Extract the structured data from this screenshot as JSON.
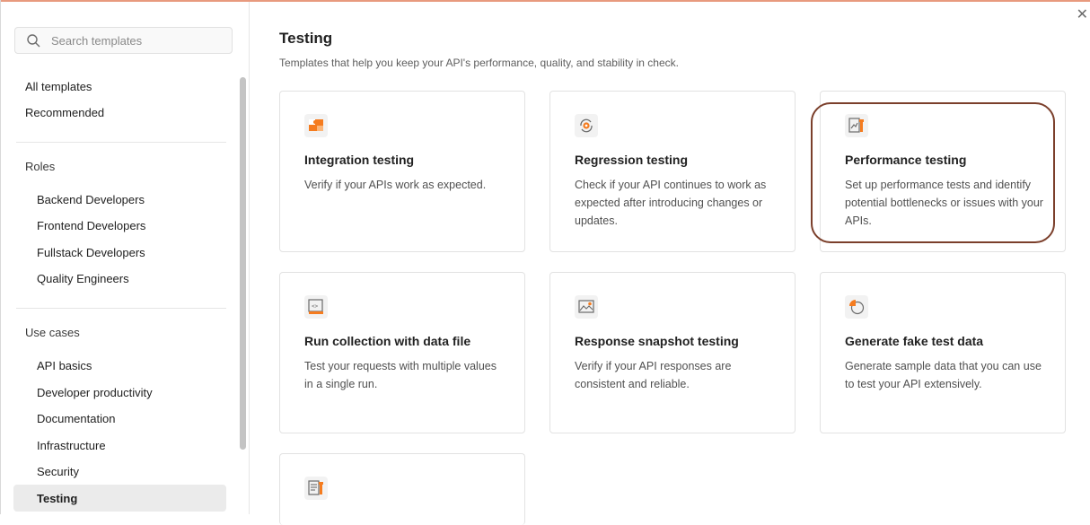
{
  "close_icon": "close-icon",
  "sidebar": {
    "search_placeholder": "Search templates",
    "top_items": [
      "All templates",
      "Recommended"
    ],
    "roles_label": "Roles",
    "roles": [
      "Backend Developers",
      "Frontend Developers",
      "Fullstack Developers",
      "Quality Engineers"
    ],
    "use_cases_label": "Use cases",
    "use_cases": [
      "API basics",
      "Developer productivity",
      "Documentation",
      "Infrastructure",
      "Security",
      "Testing"
    ],
    "active_item": "Testing"
  },
  "main": {
    "title": "Testing",
    "subtitle": "Templates that help you keep your API's performance, quality, and stability in check.",
    "cards": [
      {
        "title": "Integration testing",
        "description": "Verify if your APIs work as expected.",
        "icon": "puzzle-icon"
      },
      {
        "title": "Regression testing",
        "description": "Check if your API continues to work as expected after introducing changes or updates.",
        "icon": "gear-cycle-icon"
      },
      {
        "title": "Performance testing",
        "description": "Set up performance tests and identify potential bottlenecks or issues with your APIs.",
        "icon": "chart-wrench-icon"
      },
      {
        "title": "Run collection with data file",
        "description": "Test your requests with multiple values in a single run.",
        "icon": "code-file-icon"
      },
      {
        "title": "Response snapshot testing",
        "description": "Verify if your API responses are consistent and reliable.",
        "icon": "image-icon"
      },
      {
        "title": "Generate fake test data",
        "description": "Generate sample data that you can use to test your API extensively.",
        "icon": "pie-chart-icon"
      },
      {
        "title": "",
        "description": "",
        "icon": "document-wrench-icon"
      }
    ]
  },
  "colors": {
    "accent": "#f57c1f",
    "highlight": "#7b3f2b",
    "active_bg": "#ebebeb"
  }
}
